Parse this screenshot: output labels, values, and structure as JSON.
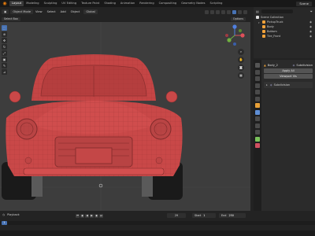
{
  "topbar": {
    "workspaces": [
      "Layout",
      "Modeling",
      "Sculpting",
      "UV Editing",
      "Texture Paint",
      "Shading",
      "Animation",
      "Rendering",
      "Compositing",
      "Geometry Nodes",
      "Scripting"
    ],
    "active_workspace": "Layout",
    "scene_label": "Scene"
  },
  "viewport_header": {
    "mode": "Object Mode",
    "view": "View",
    "select": "Select",
    "add": "Add",
    "object": "Object",
    "orientation": "Global",
    "sub_mode": "Object Mode",
    "pivot_label": "Select Box"
  },
  "header_right": {
    "options": "Options"
  },
  "outliner": {
    "title": "Scene Collection",
    "rows": [
      {
        "label": "Scene Collection",
        "depth": 0,
        "color": "#e0e0e0"
      },
      {
        "label": "PickupTruck",
        "depth": 1,
        "color": "#f2a23a"
      },
      {
        "label": "Body",
        "depth": 2,
        "color": "#f2a23a"
      },
      {
        "label": "Bottom",
        "depth": 2,
        "color": "#f2a23a"
      },
      {
        "label": "Tire_Front",
        "depth": 2,
        "color": "#f2a23a"
      }
    ]
  },
  "properties": {
    "object_name": "Body_2",
    "modifier_name": "Subdivision",
    "apply_all": "Apply All",
    "viewport_vis": "Viewport Vis",
    "panel_label": "Subdivision",
    "add_modifier": "Add Modifier"
  },
  "timeline": {
    "playback": "Playback",
    "keying": "Keying",
    "view": "View",
    "marker": "Marker",
    "current_frame": "29",
    "start_label": "Start",
    "start_value": "1",
    "end_label": "End",
    "end_value": "250",
    "frame_indicator": "1"
  },
  "colors": {
    "accent": "#4772b3",
    "car_body": "#c94848",
    "viewport_bg": "#3d3d3d"
  }
}
